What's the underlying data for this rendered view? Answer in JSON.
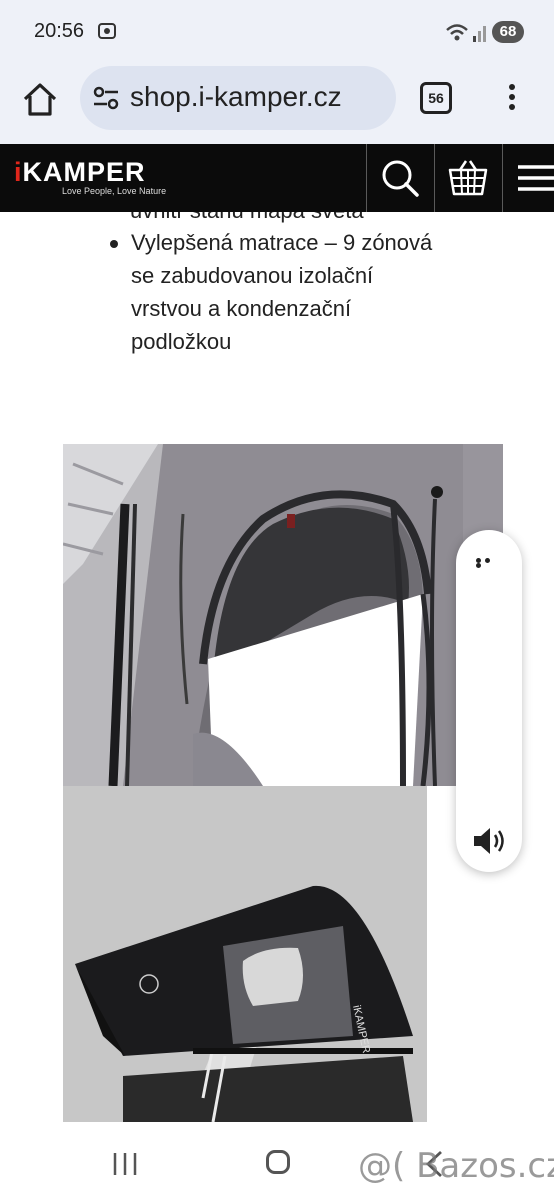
{
  "status_bar": {
    "time": "20:56",
    "battery": "68"
  },
  "browser": {
    "url": "shop.i-kamper.cz",
    "tab_count": "56"
  },
  "site": {
    "logo_text": "KAMPER",
    "logo_prefix": "i",
    "tagline": "Love People, Love Nature",
    "brand_color": "#e0261b",
    "header_bg": "#0b0b0b"
  },
  "content": {
    "cut_line": "uvnitř stanu mapa světa",
    "bullets": [
      {
        "lines": [
          "Vylepšená matrace – 9 zónová",
          "se zabudovanou izolační",
          "vrstvou a kondenzační",
          "podložkou"
        ]
      }
    ],
    "photo2_logo": "iKAMPER"
  },
  "icons": {
    "home": "home-icon",
    "site_settings": "tune-icon",
    "tabs": "tabs-icon",
    "more": "more-vert-icon",
    "search": "search-icon",
    "cart": "cart-icon",
    "menu": "hamburger-icon",
    "float_more": "more-horiz-icon",
    "float_volume": "volume-icon"
  },
  "watermark": "@( Bazos.cz"
}
